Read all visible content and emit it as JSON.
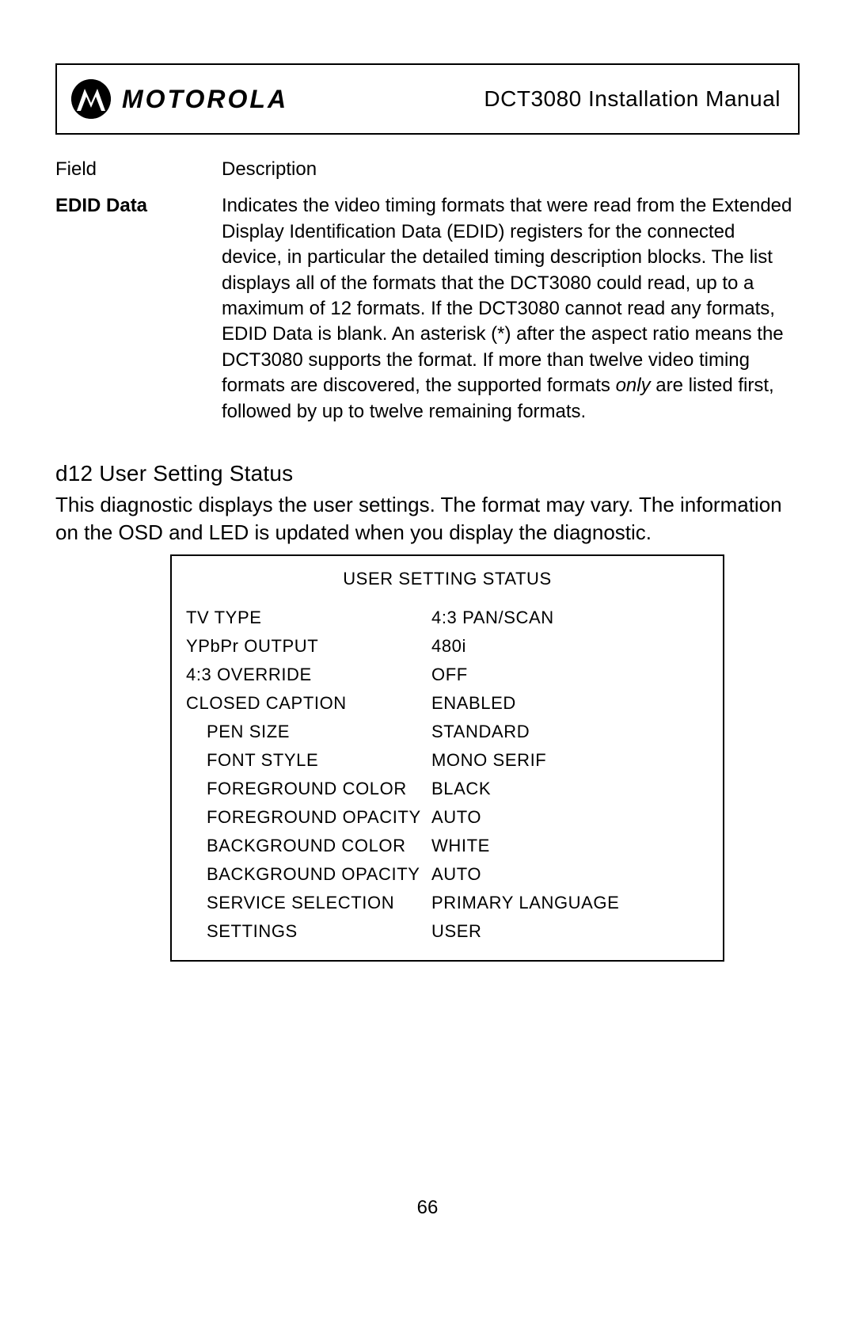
{
  "header": {
    "brand_name": "MOTOROLA",
    "doc_title": "DCT3080 Installation Manual"
  },
  "field_table": {
    "col_field": "Field",
    "col_desc": "Description",
    "row_field": "EDID Data",
    "row_desc_p1": "Indicates the video timing formats that were read from the Extended Display Identification Data (EDID) registers for the connected device, in particular the detailed timing description blocks. The list displays all of the formats that the DCT3080 could read, up to a maximum of 12 formats. If the DCT3080 cannot read any formats, EDID Data is blank. An asterisk (*) after the aspect ratio means the DCT3080 supports the format. If more than twelve video timing formats are discovered, the supported formats ",
    "row_desc_italic": "only",
    "row_desc_p2": " are listed first, followed by up to twelve remaining formats."
  },
  "section": {
    "heading": "d12 User Setting Status",
    "body": "This diagnostic displays the user settings. The format may vary.  The information on the OSD and LED is updated when you display the diagnostic."
  },
  "status_box": {
    "title": "USER SETTING STATUS",
    "rows": [
      {
        "label": "TV TYPE",
        "value": "4:3 PAN/SCAN",
        "indent": false
      },
      {
        "label": "YPbPr OUTPUT",
        "value": "480i",
        "indent": false
      },
      {
        "label": "4:3 OVERRIDE",
        "value": "OFF",
        "indent": false
      },
      {
        "label": "CLOSED CAPTION",
        "value": "ENABLED",
        "indent": false
      },
      {
        "label": "PEN SIZE",
        "value": "STANDARD",
        "indent": true
      },
      {
        "label": "FONT STYLE",
        "value": "MONO SERIF",
        "indent": true
      },
      {
        "label": "FOREGROUND COLOR",
        "value": "BLACK",
        "indent": true
      },
      {
        "label": "FOREGROUND OPACITY",
        "value": "AUTO",
        "indent": true
      },
      {
        "label": "BACKGROUND COLOR",
        "value": "WHITE",
        "indent": true
      },
      {
        "label": "BACKGROUND OPACITY",
        "value": "AUTO",
        "indent": true
      },
      {
        "label": "SERVICE SELECTION",
        "value": "PRIMARY LANGUAGE",
        "indent": true
      },
      {
        "label": "SETTINGS",
        "value": "USER",
        "indent": true
      }
    ]
  },
  "page_number": "66"
}
